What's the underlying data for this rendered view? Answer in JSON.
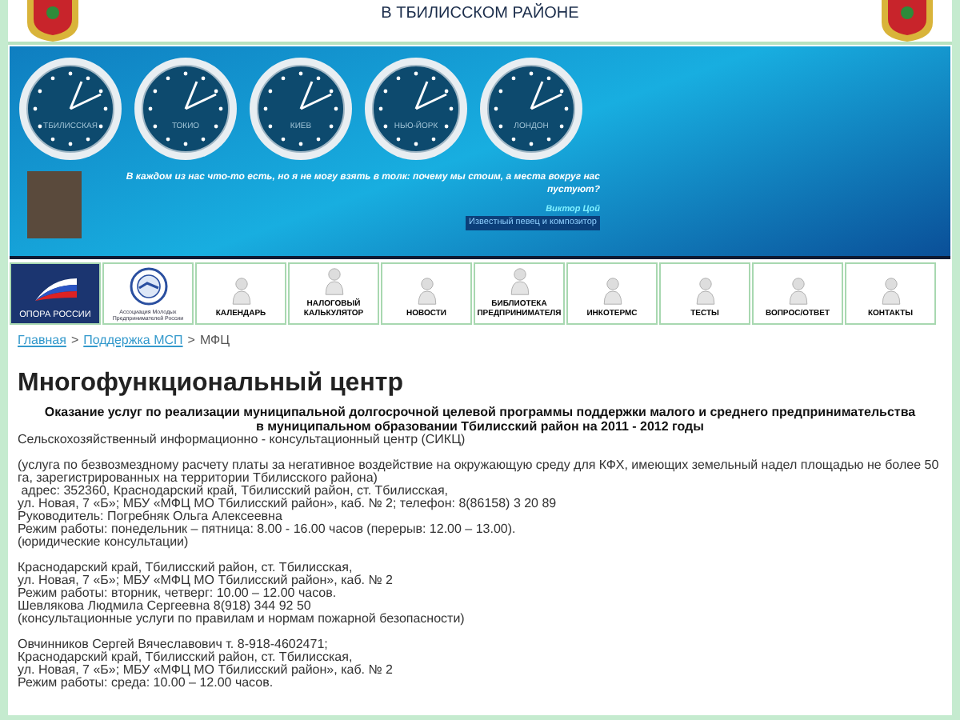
{
  "header": {
    "title": "В ТБИЛИССКОМ РАЙОНЕ"
  },
  "banner": {
    "clocks": [
      {
        "label": "ТБИЛИССКАЯ"
      },
      {
        "label": "ТОКИО"
      },
      {
        "label": "КИЕВ"
      },
      {
        "label": "НЬЮ-ЙОРК"
      },
      {
        "label": "ЛОНДОН"
      }
    ],
    "quote": {
      "text": "В каждом из нас что-то есть, но я не могу взять в толк: почему мы стоим, а места вокруг нас пустуют?",
      "author": "Виктор Цой",
      "author_note": "Известный певец и композитор"
    }
  },
  "nav": [
    {
      "label": "ОПОРА РОССИИ",
      "kind": "logo-flag"
    },
    {
      "label": "Ассоциация Молодых Предпринимателей России",
      "kind": "logo-seal"
    },
    {
      "label": "КАЛЕНДАРЬ",
      "kind": "tile"
    },
    {
      "label": "НАЛОГОВЫЙ КАЛЬКУЛЯТОР",
      "kind": "tile"
    },
    {
      "label": "НОВОСТИ",
      "kind": "tile"
    },
    {
      "label": "БИБЛИОТЕКА ПРЕДПРИНИМАТЕЛЯ",
      "kind": "tile"
    },
    {
      "label": "ИНКОТЕРМС",
      "kind": "tile"
    },
    {
      "label": "ТЕСТЫ",
      "kind": "tile"
    },
    {
      "label": "ВОПРОС/ОТВЕТ",
      "kind": "tile"
    },
    {
      "label": "КОНТАКТЫ",
      "kind": "tile"
    }
  ],
  "breadcrumb": [
    {
      "label": "Главная",
      "kind": "link"
    },
    {
      "label": ">",
      "kind": "sep"
    },
    {
      "label": "Поддержка МСП",
      "kind": "link"
    },
    {
      "label": ">",
      "kind": "sep"
    },
    {
      "label": "МФЦ",
      "kind": "current"
    }
  ],
  "page_title": "Многофункциональный центр",
  "subtitle": "Оказание услуг по реализации муниципальной долгосрочной целевой программы поддержки малого и среднего предпринимательства в муниципальном образовании Тбилисский район на 2011 - 2012 годы",
  "blocks": [
    [
      "Сельскохозяйственный информационно - консультационный центр (СИКЦ)"
    ],
    [
      "(услуга по безвозмездному расчету платы за негативное воздействие на окружающую среду для КФХ, имеющих земельный надел площадью не более 50 га, зарегистрированных на территории Тбилисского района)",
      " адрес: 352360, Краснодарский край, Тбилисский район, ст. Тбилисская,",
      "ул. Новая, 7 «Б»; МБУ «МФЦ МО Тбилисский район», каб. № 2; телефон: 8(86158) 3 20 89",
      "Руководитель: Погребняк Ольга Алексеевна",
      "Режим работы: понедельник – пятница: 8.00 - 16.00 часов (перерыв: 12.00 – 13.00).",
      "(юридические консультации)"
    ],
    [
      "Краснодарский край, Тбилисский район, ст. Тбилисская,",
      "ул. Новая, 7 «Б»; МБУ «МФЦ МО Тбилисский район», каб. № 2",
      "Режим работы: вторник, четверг: 10.00 – 12.00 часов.",
      "Шевлякова Людмила Сергеевна 8(918) 344 92 50",
      "(консультационные услуги по правилам и нормам пожарной безопасности)"
    ],
    [
      "Овчинников Сергей Вячеславович т. 8-918-4602471;",
      "Краснодарский край, Тбилисский район, ст. Тбилисская,",
      "ул. Новая, 7 «Б»; МБУ «МФЦ МО Тбилисский район», каб. № 2",
      "Режим работы: среда: 10.00 – 12.00 часов."
    ]
  ]
}
